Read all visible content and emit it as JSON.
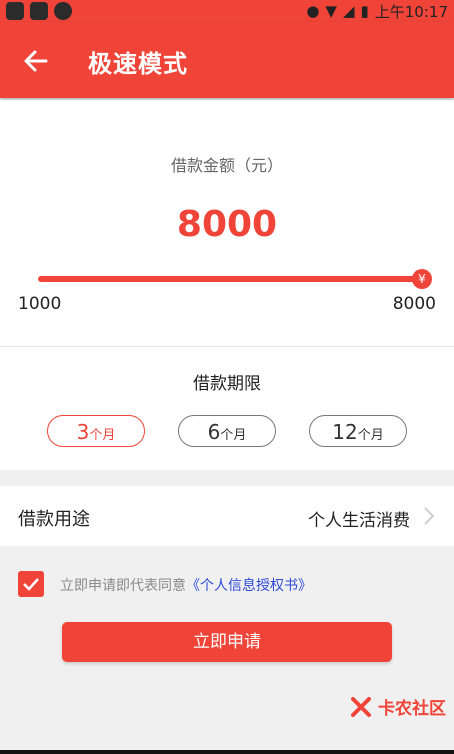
{
  "status_bar": {
    "time": "上午10:17"
  },
  "header": {
    "title": "极速模式"
  },
  "loan_amount": {
    "label": "借款金额（元）",
    "value": "8000",
    "min_label": "1000",
    "max_label": "8000",
    "thumb_symbol": "¥",
    "slider_fraction": 1.0
  },
  "loan_term": {
    "label": "借款期限",
    "options": [
      {
        "num": "3",
        "unit": "个月",
        "selected": true
      },
      {
        "num": "6",
        "unit": "个月",
        "selected": false
      },
      {
        "num": "12",
        "unit": "个月",
        "selected": false
      }
    ]
  },
  "loan_purpose": {
    "label": "借款用途",
    "value": "个人生活消费"
  },
  "agreement": {
    "prefix": "立即申请即代表同意",
    "link": "《个人信息授权书》",
    "checked": true
  },
  "apply_button": {
    "label": "立即申请"
  },
  "watermark": {
    "text": "卡农社区"
  },
  "colors": {
    "primary": "#f04438",
    "link": "#2f4bd6"
  }
}
